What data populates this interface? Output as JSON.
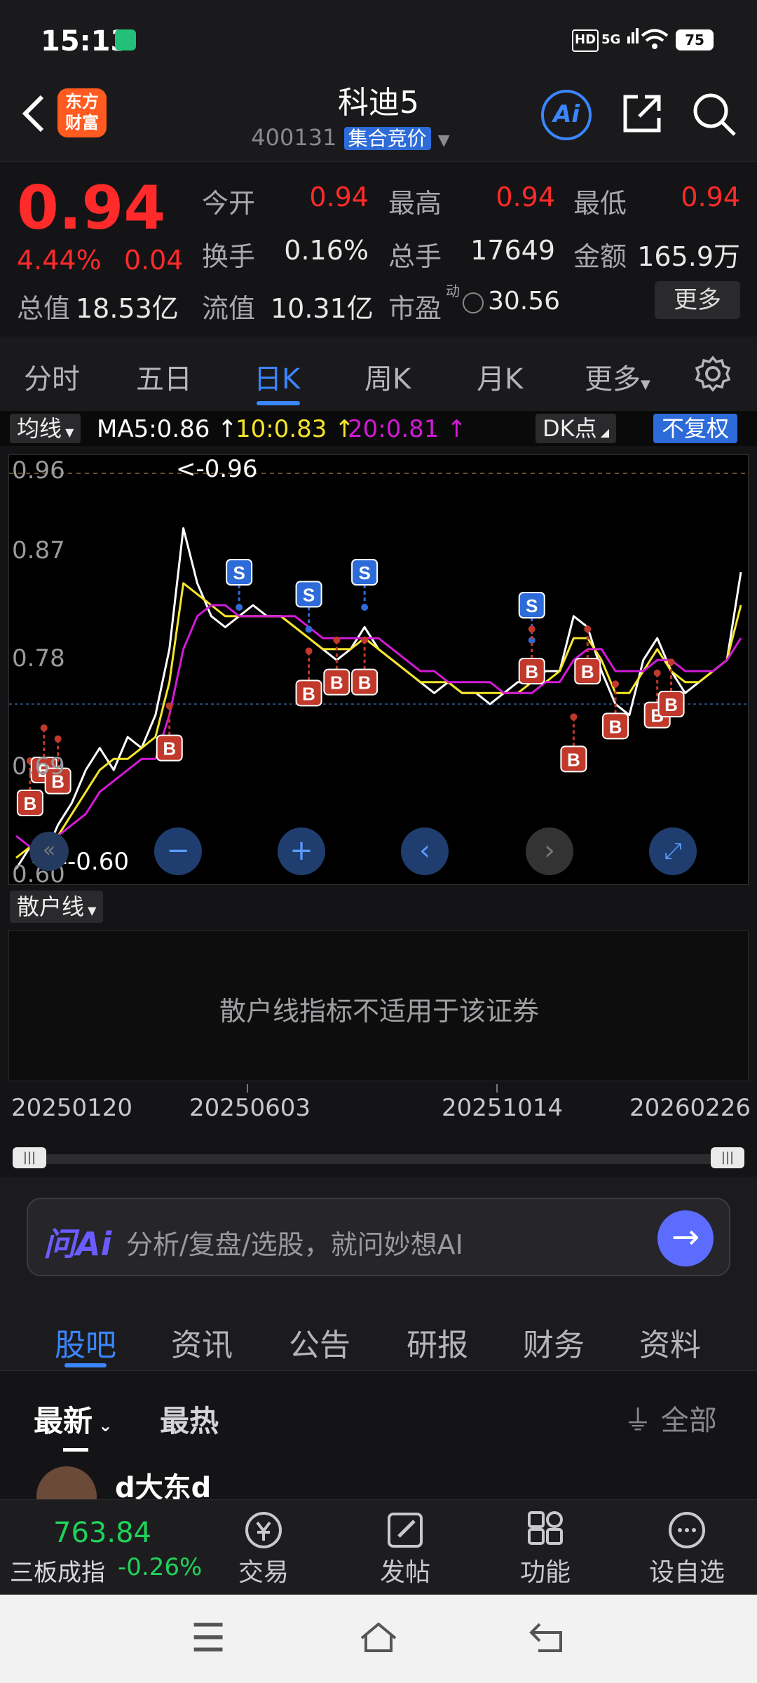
{
  "status": {
    "time": "15:13",
    "hd": "HD",
    "net": "5G",
    "battery": "75"
  },
  "header": {
    "back_icon": "chevron-left-icon",
    "logo_line1": "东方",
    "logo_line2": "财富",
    "title": "科迪5",
    "code": "400131",
    "tag": "集合竞价",
    "ai": "Ai"
  },
  "quote": {
    "price": "0.94",
    "pct": "4.44%",
    "chg": "0.04",
    "open_label": "今开",
    "open": "0.94",
    "high_label": "最高",
    "high": "0.94",
    "low_label": "最低",
    "low": "0.94",
    "turnover_label": "换手",
    "turnover": "0.16%",
    "volume_label": "总手",
    "volume": "17649",
    "amount_label": "金额",
    "amount": "165.9万",
    "mcap_label": "总值",
    "mcap": "18.53亿",
    "float_label": "流值",
    "float": "10.31亿",
    "pe_label": "市盈",
    "pe_sup": "动",
    "pe": "30.56",
    "more": "更多"
  },
  "tabs": [
    "分时",
    "五日",
    "日K",
    "周K",
    "月K",
    "更多"
  ],
  "indicator": {
    "ma_btn": "均线",
    "ma5": "MA5:0.86",
    "ma10": "10:0.83",
    "ma20": "20:0.81",
    "dk": "DK点",
    "fq": "不复权",
    "colors": {
      "ma5": "#ffffff",
      "ma10": "#f5e52b",
      "ma20": "#d21ad6"
    }
  },
  "chart": {
    "y_labels": [
      "0.96",
      "0.87",
      "0.78",
      "0.69",
      "0.60"
    ],
    "max_note": "<-0.96",
    "min_note": "<---0.60"
  },
  "chart_data": {
    "type": "line",
    "ylim": [
      0.6,
      0.96
    ],
    "x_ticks": [
      "20250120",
      "20250603",
      "20251014",
      "20260226"
    ],
    "series": [
      {
        "name": "MA5",
        "values": [
          0.6,
          0.62,
          0.61,
          0.64,
          0.66,
          0.69,
          0.71,
          0.69,
          0.72,
          0.71,
          0.74,
          0.8,
          0.91,
          0.86,
          0.83,
          0.82,
          0.83,
          0.84,
          0.83,
          0.83,
          0.82,
          0.81,
          0.8,
          0.79,
          0.8,
          0.82,
          0.8,
          0.79,
          0.78,
          0.77,
          0.76,
          0.77,
          0.76,
          0.76,
          0.75,
          0.76,
          0.77,
          0.77,
          0.78,
          0.78,
          0.83,
          0.82,
          0.78,
          0.75,
          0.74,
          0.79,
          0.81,
          0.78,
          0.76,
          0.77,
          0.78,
          0.79,
          0.87
        ]
      },
      {
        "name": "10",
        "values": [
          0.61,
          0.62,
          0.63,
          0.63,
          0.65,
          0.67,
          0.69,
          0.7,
          0.7,
          0.71,
          0.72,
          0.77,
          0.86,
          0.85,
          0.84,
          0.83,
          0.83,
          0.83,
          0.83,
          0.83,
          0.82,
          0.81,
          0.8,
          0.8,
          0.8,
          0.81,
          0.8,
          0.79,
          0.78,
          0.77,
          0.77,
          0.77,
          0.76,
          0.76,
          0.76,
          0.76,
          0.76,
          0.77,
          0.77,
          0.78,
          0.81,
          0.81,
          0.79,
          0.76,
          0.76,
          0.78,
          0.8,
          0.78,
          0.77,
          0.77,
          0.78,
          0.79,
          0.84
        ]
      },
      {
        "name": "20",
        "values": [
          0.63,
          0.62,
          0.63,
          0.63,
          0.64,
          0.65,
          0.67,
          0.68,
          0.69,
          0.7,
          0.7,
          0.74,
          0.8,
          0.83,
          0.84,
          0.84,
          0.83,
          0.83,
          0.83,
          0.83,
          0.83,
          0.82,
          0.81,
          0.81,
          0.81,
          0.81,
          0.81,
          0.8,
          0.79,
          0.78,
          0.78,
          0.77,
          0.77,
          0.77,
          0.77,
          0.76,
          0.76,
          0.76,
          0.77,
          0.77,
          0.79,
          0.8,
          0.8,
          0.78,
          0.78,
          0.78,
          0.79,
          0.79,
          0.78,
          0.78,
          0.78,
          0.79,
          0.81
        ]
      }
    ],
    "signals": [
      {
        "label": "B",
        "i": 1,
        "v": 0.66
      },
      {
        "label": "B",
        "i": 2,
        "v": 0.69
      },
      {
        "label": "B",
        "i": 3,
        "v": 0.68
      },
      {
        "label": "B",
        "i": 11,
        "v": 0.71
      },
      {
        "label": "S",
        "i": 16,
        "v": 0.87
      },
      {
        "label": "S",
        "i": 21,
        "v": 0.85
      },
      {
        "label": "B",
        "i": 21,
        "v": 0.76
      },
      {
        "label": "B",
        "i": 23,
        "v": 0.77
      },
      {
        "label": "S",
        "i": 25,
        "v": 0.87
      },
      {
        "label": "B",
        "i": 25,
        "v": 0.77
      },
      {
        "label": "S",
        "i": 37,
        "v": 0.84
      },
      {
        "label": "B",
        "i": 37,
        "v": 0.78
      },
      {
        "label": "B",
        "i": 40,
        "v": 0.7
      },
      {
        "label": "B",
        "i": 41,
        "v": 0.78
      },
      {
        "label": "B",
        "i": 43,
        "v": 0.73
      },
      {
        "label": "B",
        "i": 46,
        "v": 0.74
      },
      {
        "label": "B",
        "i": 47,
        "v": 0.75
      }
    ]
  },
  "sub": {
    "btn": "散户线",
    "msg": "散户线指标不适用于该证券"
  },
  "ai_input": {
    "logo": "问Ai",
    "placeholder": "分析/复盘/选股，就问妙想AI"
  },
  "lower_tabs": [
    "股吧",
    "资讯",
    "公告",
    "研报",
    "财务",
    "资料"
  ],
  "filter": {
    "latest": "最新",
    "hot": "最热",
    "all": "全部",
    "poster_partial": "d大东d"
  },
  "bottom": {
    "index_value": "763.84",
    "index_name": "三板成指",
    "index_change": "-0.26%",
    "items": [
      {
        "label": "交易",
        "icon": "yen-icon"
      },
      {
        "label": "发帖",
        "icon": "edit-icon"
      },
      {
        "label": "功能",
        "icon": "grid-icon"
      },
      {
        "label": "设自选",
        "icon": "more-icon"
      }
    ]
  }
}
